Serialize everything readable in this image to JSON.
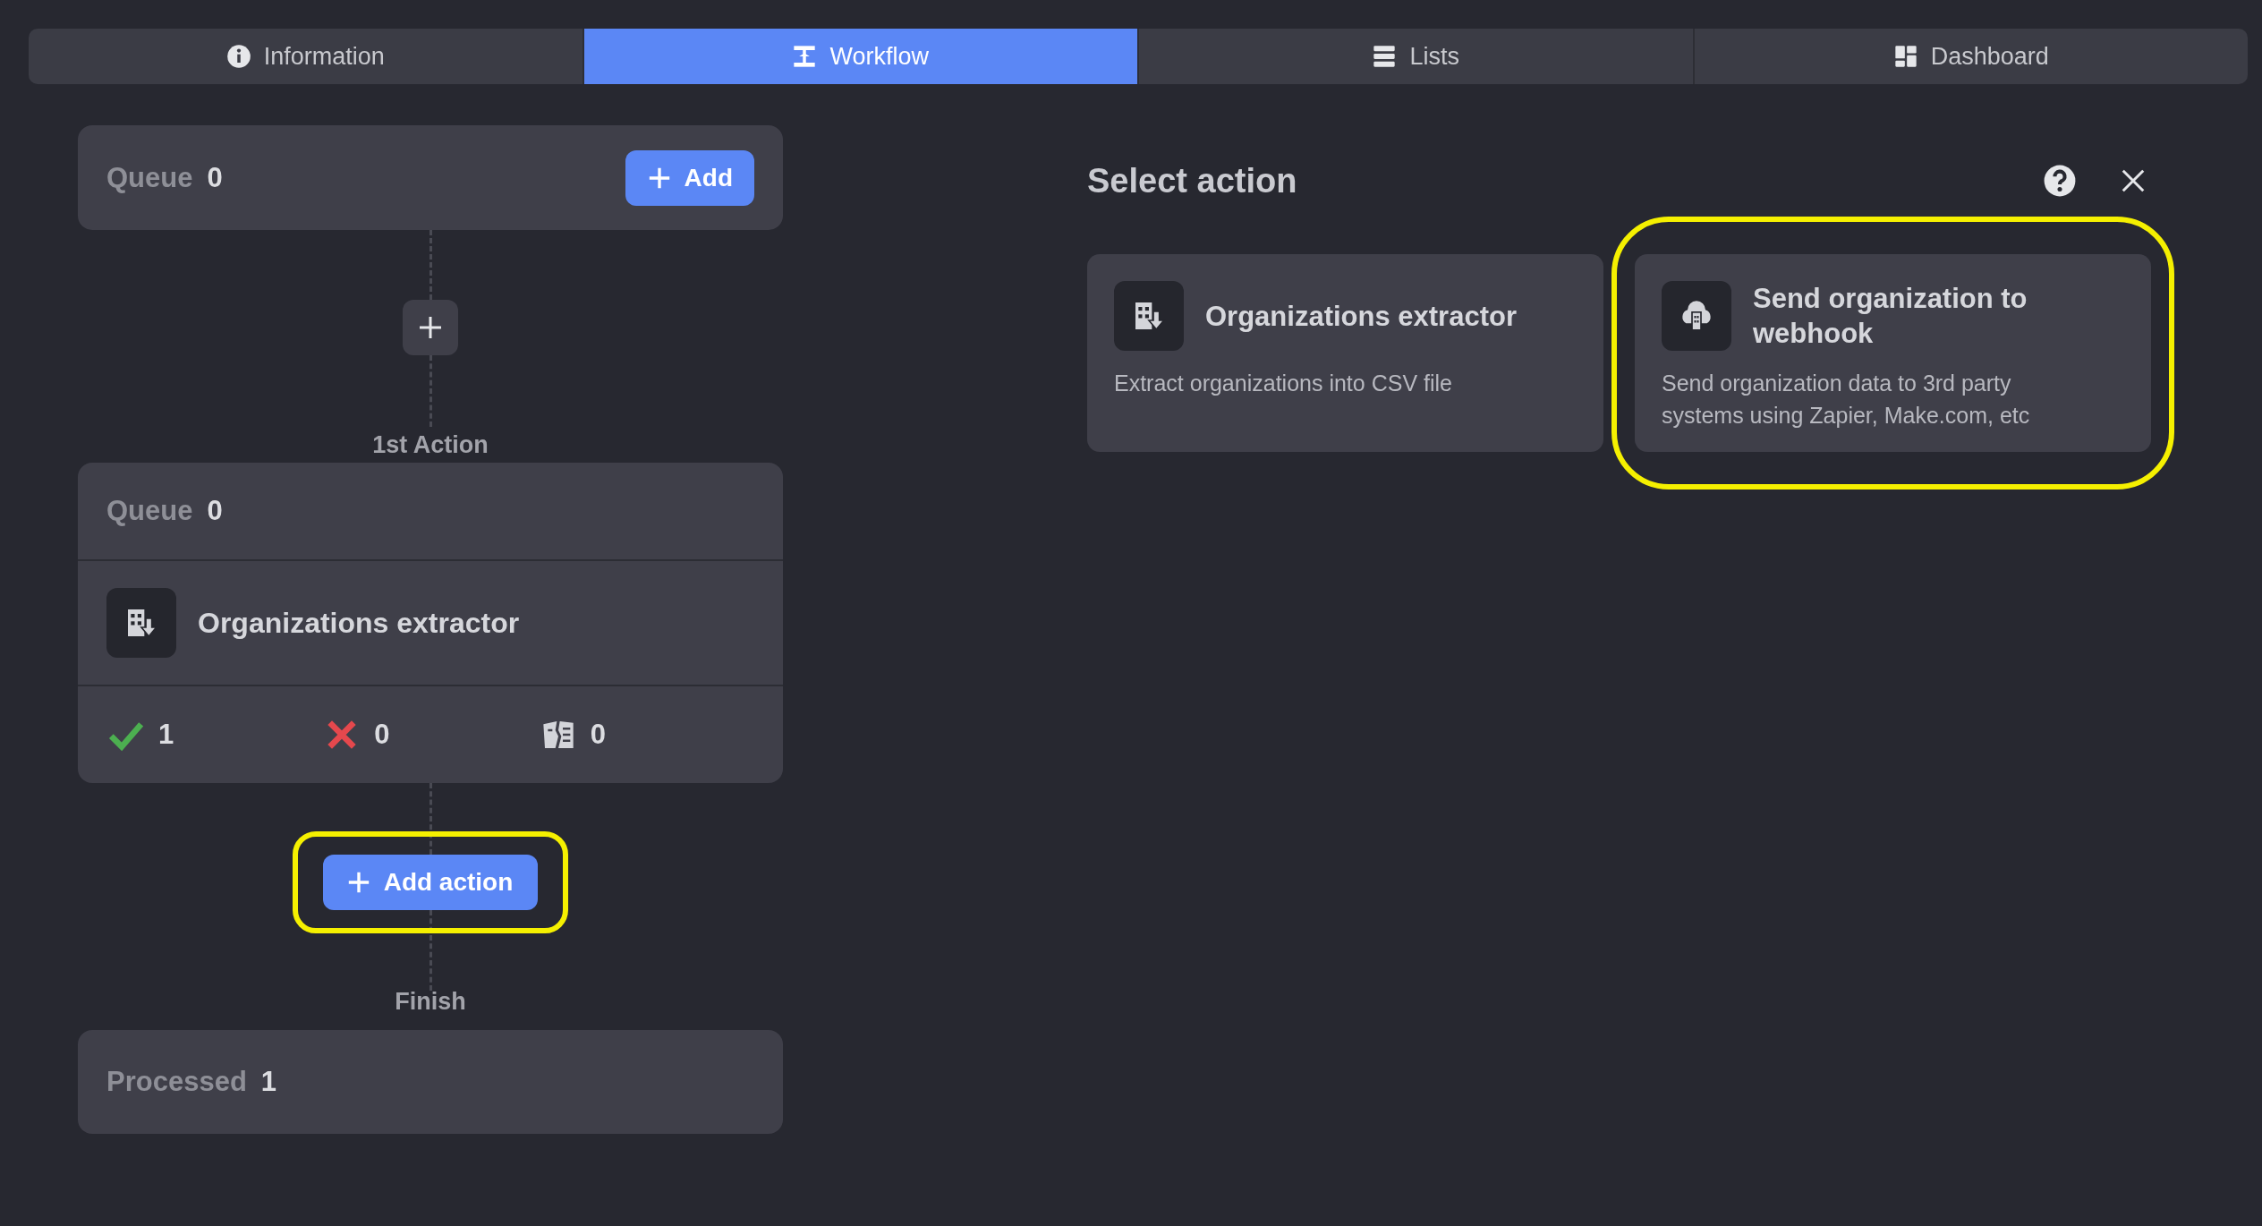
{
  "tabs": [
    {
      "label": "Information",
      "kind": "info",
      "selected": false
    },
    {
      "label": "Workflow",
      "kind": "workflow",
      "selected": true
    },
    {
      "label": "Lists",
      "kind": "lists",
      "selected": false
    },
    {
      "label": "Dashboard",
      "kind": "dashboard",
      "selected": false
    }
  ],
  "workflow": {
    "start": {
      "label": "Queue",
      "count": "0",
      "button": "Add"
    },
    "step_label": "1st Action",
    "action": {
      "queue_label": "Queue",
      "queue_count": "0",
      "kind": "extractor",
      "name": "Organizations extractor",
      "stats": [
        {
          "kind": "success",
          "value": "1"
        },
        {
          "kind": "error",
          "value": "0"
        },
        {
          "kind": "skipped",
          "value": "0"
        }
      ]
    },
    "add_action": {
      "label": "Add action",
      "highlighted": true
    },
    "finish_label": "Finish",
    "end": {
      "label": "Processed",
      "count": "1"
    }
  },
  "panel": {
    "title": "Select action",
    "actions": [
      {
        "kind": "extractor",
        "title": "Organizations extractor",
        "description": "Extract organizations into CSV file",
        "highlighted": false
      },
      {
        "kind": "webhook",
        "title": "Send organization to webhook",
        "description": "Send organization data to 3rd party systems using Zapier, Make.com, etc",
        "highlighted": true
      }
    ]
  }
}
